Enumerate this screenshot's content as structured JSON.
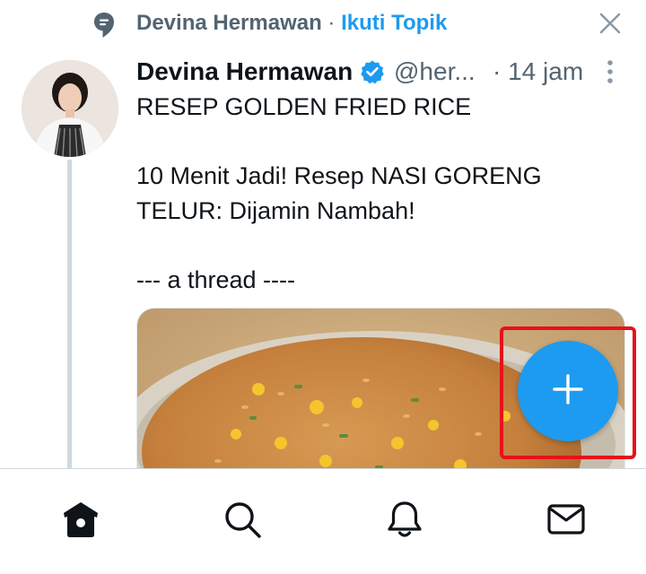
{
  "topic": {
    "name": "Devina Hermawan",
    "separator": " · ",
    "follow_label": "Ikuti Topik",
    "topic_icon": "topic-speech-bubble-icon",
    "dismiss_icon": "close-icon"
  },
  "tweet": {
    "author_name": "Devina Hermawan",
    "verified_icon": "verified-badge-icon",
    "handle": "@her...",
    "time": "· 14 jam",
    "more_icon": "more-vertical-icon",
    "lines": [
      "RESEP GOLDEN FRIED RICE",
      "10 Menit Jadi! Resep NASI GORENG TELUR: Dijamin Nambah!",
      "--- a thread ----"
    ],
    "media_icon": "fried-rice-photo"
  },
  "fab": {
    "icon": "plus-icon"
  },
  "nav": {
    "items": [
      {
        "icon": "home-icon"
      },
      {
        "icon": "search-icon"
      },
      {
        "icon": "bell-icon"
      },
      {
        "icon": "mail-icon"
      }
    ]
  },
  "colors": {
    "accent": "#1d9bf0",
    "text": "#0f1419",
    "muted": "#536471",
    "highlight": "#e5121b",
    "thread_line": "#cfd9de"
  }
}
